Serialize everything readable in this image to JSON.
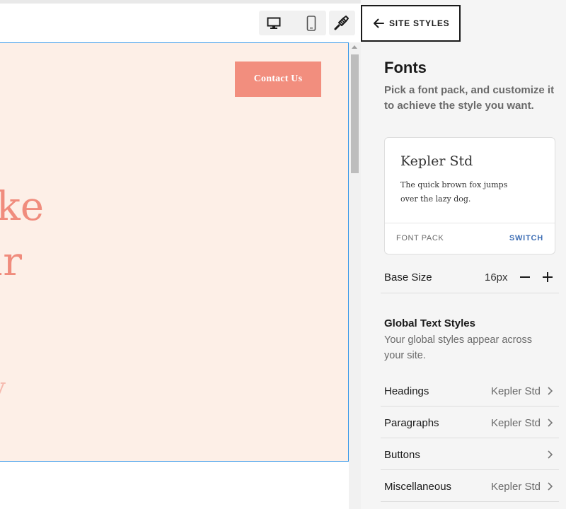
{
  "canvas": {
    "contact_button": "Contact Us",
    "hero_line_1": "ke",
    "hero_line_2": "ur",
    "hero_tail": "y"
  },
  "panel": {
    "back_label": "SITE STYLES",
    "title": "Fonts",
    "description": "Pick a font pack, and customize it to achieve the style you want.",
    "font_pack": {
      "name": "Kepler Std",
      "sample": "The quick brown fox jumps over the lazy dog.",
      "label": "FONT PACK",
      "switch_label": "SWITCH"
    },
    "base_size": {
      "label": "Base Size",
      "value": "16px"
    },
    "global_text_styles": {
      "title": "Global Text Styles",
      "description": "Your global styles appear across your site.",
      "rows": [
        {
          "label": "Headings",
          "value": "Kepler Std"
        },
        {
          "label": "Paragraphs",
          "value": "Kepler Std"
        },
        {
          "label": "Buttons",
          "value": ""
        },
        {
          "label": "Miscellaneous",
          "value": "Kepler Std"
        }
      ]
    }
  },
  "colors": {
    "canvas_bg": "#fdefe7",
    "accent": "#f28e7e",
    "selection_border": "#3d9ae8",
    "switch_link": "#3f6fb5"
  },
  "icons": {
    "desktop": "desktop-icon",
    "mobile": "mobile-icon",
    "design": "paintbrush-icon",
    "back": "arrow-left-icon",
    "minus": "minus-icon",
    "plus": "plus-icon",
    "chevron": "chevron-right-icon"
  }
}
